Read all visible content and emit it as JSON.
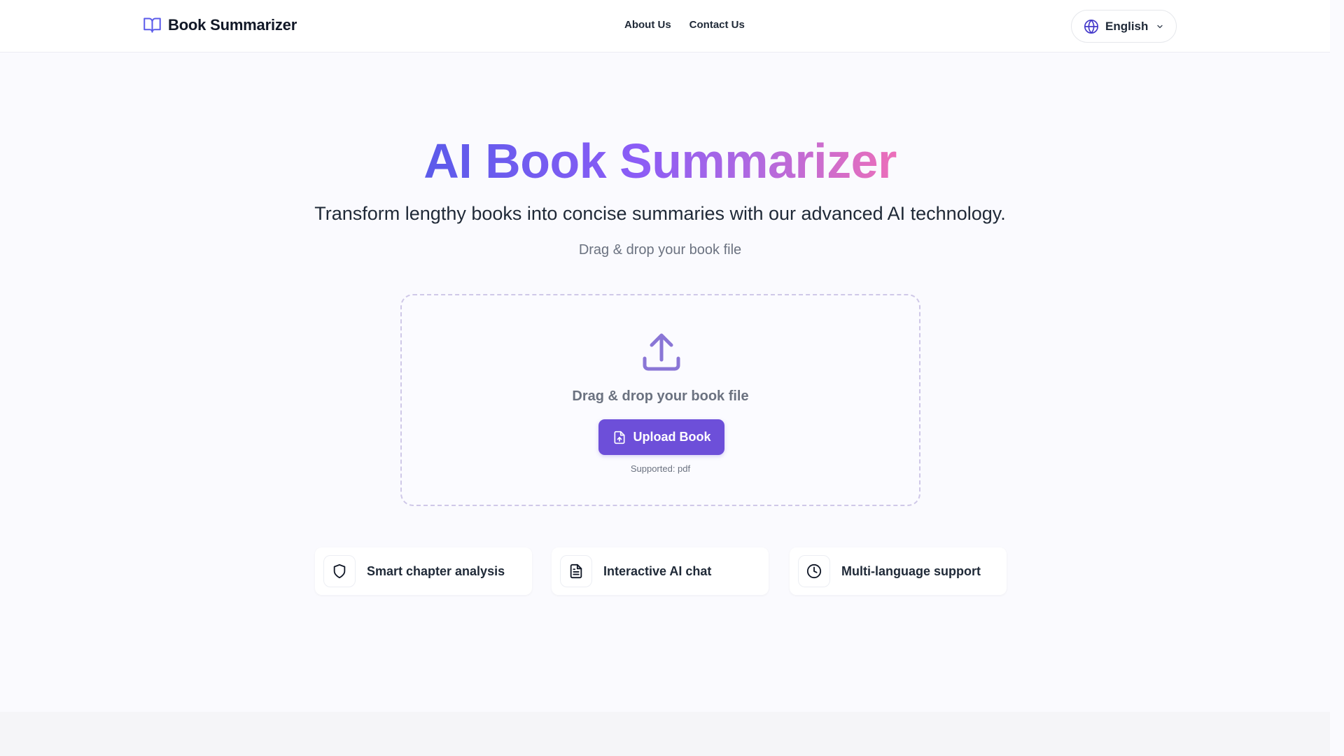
{
  "header": {
    "brand": {
      "name": "Book Summarizer",
      "icon": "book-open-icon"
    },
    "nav": [
      {
        "label": "About Us"
      },
      {
        "label": "Contact Us"
      }
    ],
    "language": {
      "selected": "English",
      "icon": "globe-icon",
      "chevron": "chevron-down-icon"
    }
  },
  "hero": {
    "title": "AI Book Summarizer",
    "subtitle": "Transform lengthy books into concise summaries with our advanced AI technology.",
    "hint": "Drag & drop your book file"
  },
  "dropzone": {
    "icon": "upload-icon",
    "text": "Drag & drop your book file",
    "button_label": "Upload Book",
    "button_icon": "file-upload-icon",
    "supported": "Supported: pdf"
  },
  "features": [
    {
      "label": "Smart chapter analysis",
      "icon": "shield-icon"
    },
    {
      "label": "Interactive AI chat",
      "icon": "document-icon"
    },
    {
      "label": "Multi-language support",
      "icon": "clock-icon"
    }
  ],
  "colors": {
    "accent": "#6d4fd9",
    "gradient_start": "#5b5bea",
    "gradient_end": "#ec6fb9",
    "background": "#fafafe",
    "text": "#1f2937",
    "muted": "#6b7280"
  }
}
